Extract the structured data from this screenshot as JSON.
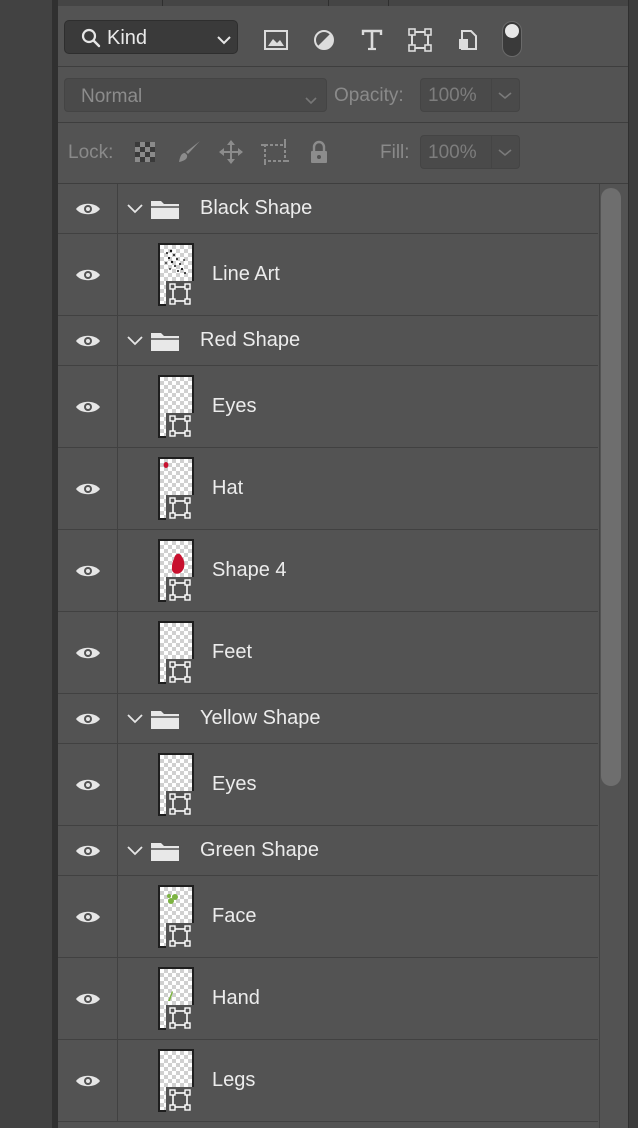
{
  "filter_bar": {
    "kind_label": "Kind",
    "icons": [
      "image-filter-icon",
      "adjustment-filter-icon",
      "type-filter-icon",
      "shape-filter-icon",
      "smart-object-filter-icon"
    ],
    "toggle_on": true
  },
  "blend_bar": {
    "mode": "Normal",
    "opacity_label": "Opacity:",
    "opacity_value": "100%"
  },
  "lock_bar": {
    "lock_label": "Lock:",
    "fill_label": "Fill:",
    "fill_value": "100%"
  },
  "layers": [
    {
      "kind": "group",
      "name": "Black Shape"
    },
    {
      "kind": "layer",
      "name": "Line Art",
      "thumb": "line-art"
    },
    {
      "kind": "group",
      "name": "Red Shape"
    },
    {
      "kind": "layer",
      "name": "Eyes",
      "thumb": "empty"
    },
    {
      "kind": "layer",
      "name": "Hat",
      "thumb": "red-dot"
    },
    {
      "kind": "layer",
      "name": "Shape 4",
      "thumb": "red-blob"
    },
    {
      "kind": "layer",
      "name": "Feet",
      "thumb": "empty"
    },
    {
      "kind": "group",
      "name": "Yellow Shape"
    },
    {
      "kind": "layer",
      "name": "Eyes",
      "thumb": "empty"
    },
    {
      "kind": "group",
      "name": "Green Shape"
    },
    {
      "kind": "layer",
      "name": "Face",
      "thumb": "green-dots"
    },
    {
      "kind": "layer",
      "name": "Hand",
      "thumb": "green-stroke"
    },
    {
      "kind": "layer",
      "name": "Legs",
      "thumb": "empty"
    }
  ],
  "colors": {
    "panel": "#535353",
    "background": "#3c3c3c",
    "red_art": "#c8102e",
    "green_art": "#7cb342"
  }
}
